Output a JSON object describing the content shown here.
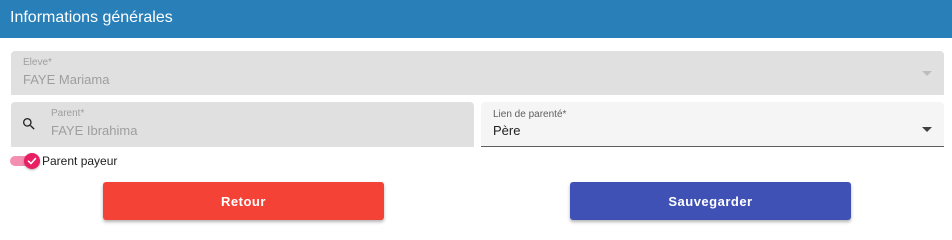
{
  "header": {
    "title": "Informations générales"
  },
  "eleve": {
    "label": "Eleve*",
    "value": "FAYE Mariama",
    "icon": "dropdown-arrow-icon"
  },
  "parent": {
    "label": "Parent*",
    "value": "FAYE Ibrahima",
    "icon": "search-icon"
  },
  "lien": {
    "label": "Lien de parenté*",
    "value": "Père",
    "icon": "dropdown-arrow-icon"
  },
  "toggle": {
    "label": "Parent payeur",
    "checked": true,
    "color": "#e91e63"
  },
  "buttons": {
    "retour": {
      "label": "Retour",
      "color": "#f44336"
    },
    "save": {
      "label": "Sauvegarder",
      "color": "#3f51b5"
    }
  },
  "colors": {
    "header": "#2980b9",
    "disabled_field": "#e0e0e0",
    "enabled_field": "#f5f5f5"
  }
}
